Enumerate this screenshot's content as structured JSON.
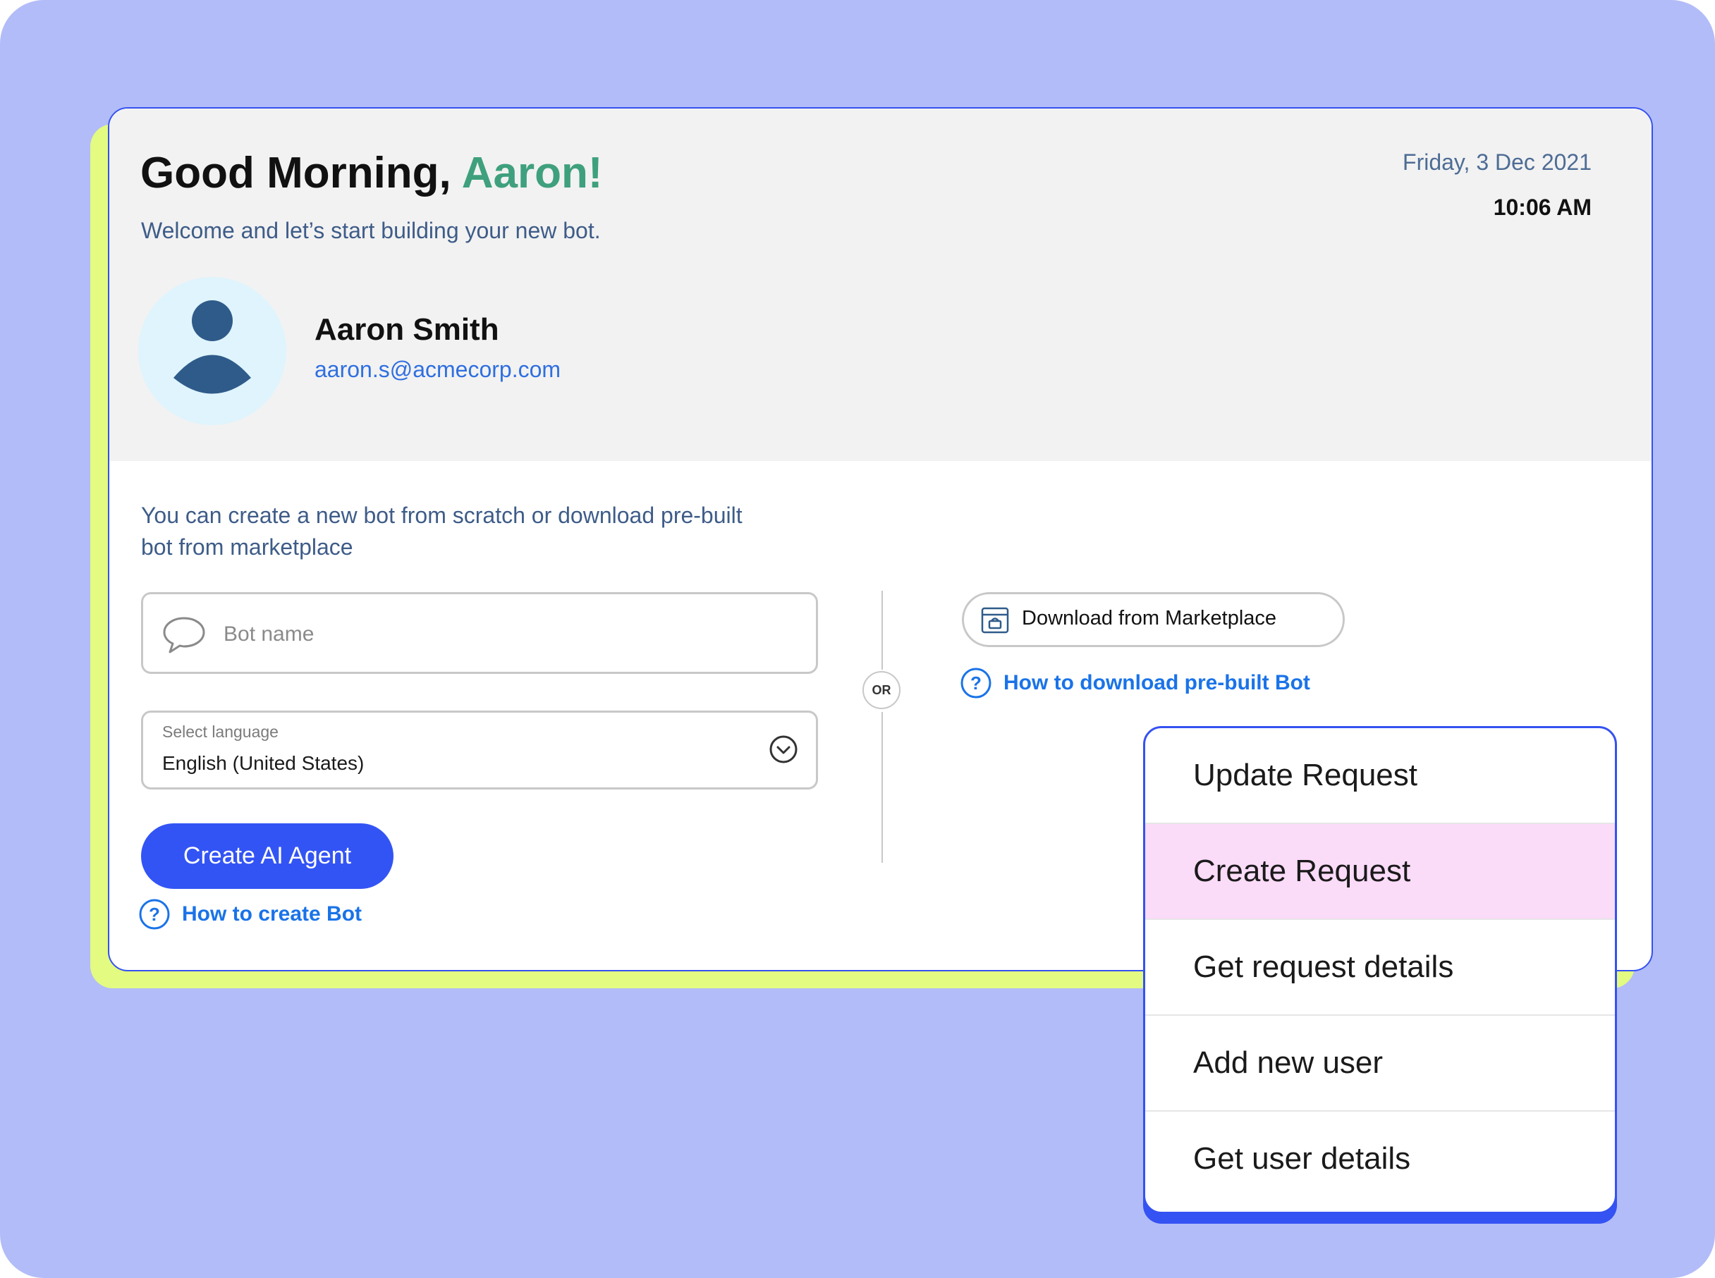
{
  "header": {
    "greeting": "Good Morning,",
    "greeting_name": "Aaron!",
    "subtitle": "Welcome and let’s start building your new bot.",
    "date": "Friday, 3 Dec 2021",
    "time": "10:06 AM"
  },
  "user": {
    "name": "Aaron Smith",
    "email": "aaron.s@acmecorp.com",
    "avatar_icon": "person-icon"
  },
  "main": {
    "intro": "You can create a new bot from scratch or download pre-built bot from marketplace",
    "bot_name_placeholder": "Bot name",
    "language_label": "Select language",
    "language_value": "English (United States)",
    "create_button": "Create AI Agent",
    "help_create": "How to create Bot",
    "or_label": "OR",
    "marketplace_button": "Download from Marketplace",
    "help_download": "How to download pre-built Bot"
  },
  "menu": {
    "items": [
      {
        "label": "Update Request"
      },
      {
        "label": "Create Request"
      },
      {
        "label": "Get request details"
      },
      {
        "label": "Add new user"
      },
      {
        "label": "Get user details"
      }
    ],
    "active_index": 1
  },
  "colors": {
    "background": "#b2bcf8",
    "accent_yellow": "#e3fb81",
    "primary_blue": "#3354f4",
    "name_green": "#3fa07d",
    "link_blue": "#1a73e8",
    "highlight_pink": "#fadbf8"
  }
}
